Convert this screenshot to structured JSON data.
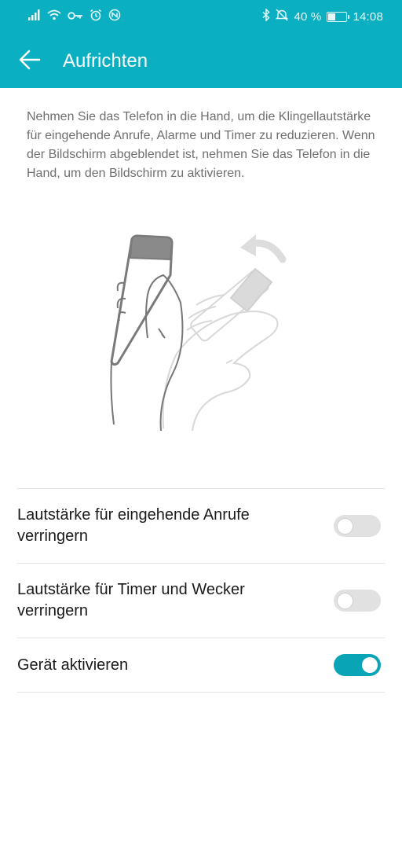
{
  "status_bar": {
    "battery_percent_text": "40 %",
    "battery_level": 0.4,
    "time": "14:08",
    "icons_left": [
      "signal-icon",
      "wifi-icon",
      "vpn-key-icon",
      "alarm-icon",
      "nfc-icon"
    ],
    "icons_right": [
      "bluetooth-icon",
      "mute-icon",
      "battery-icon"
    ]
  },
  "toolbar": {
    "title": "Aufrichten"
  },
  "description": "Nehmen Sie das Telefon in die Hand, um die Klingellautstärke für eingehende Anrufe, Alarme und Timer zu reduzieren. Wenn der Bildschirm abgeblendet ist, nehmen Sie das Telefon in die Hand, um den Bildschirm zu aktivieren.",
  "settings": [
    {
      "label": "Lautstärke für eingehende Anrufe verringern",
      "enabled": false
    },
    {
      "label": "Lautstärke für Timer und Wecker verringern",
      "enabled": false
    },
    {
      "label": "Gerät aktivieren",
      "enabled": true
    }
  ],
  "colors": {
    "accent": "#0aafc1",
    "toggle_on": "#0aa4b7",
    "toggle_off": "#e1e1e1"
  }
}
